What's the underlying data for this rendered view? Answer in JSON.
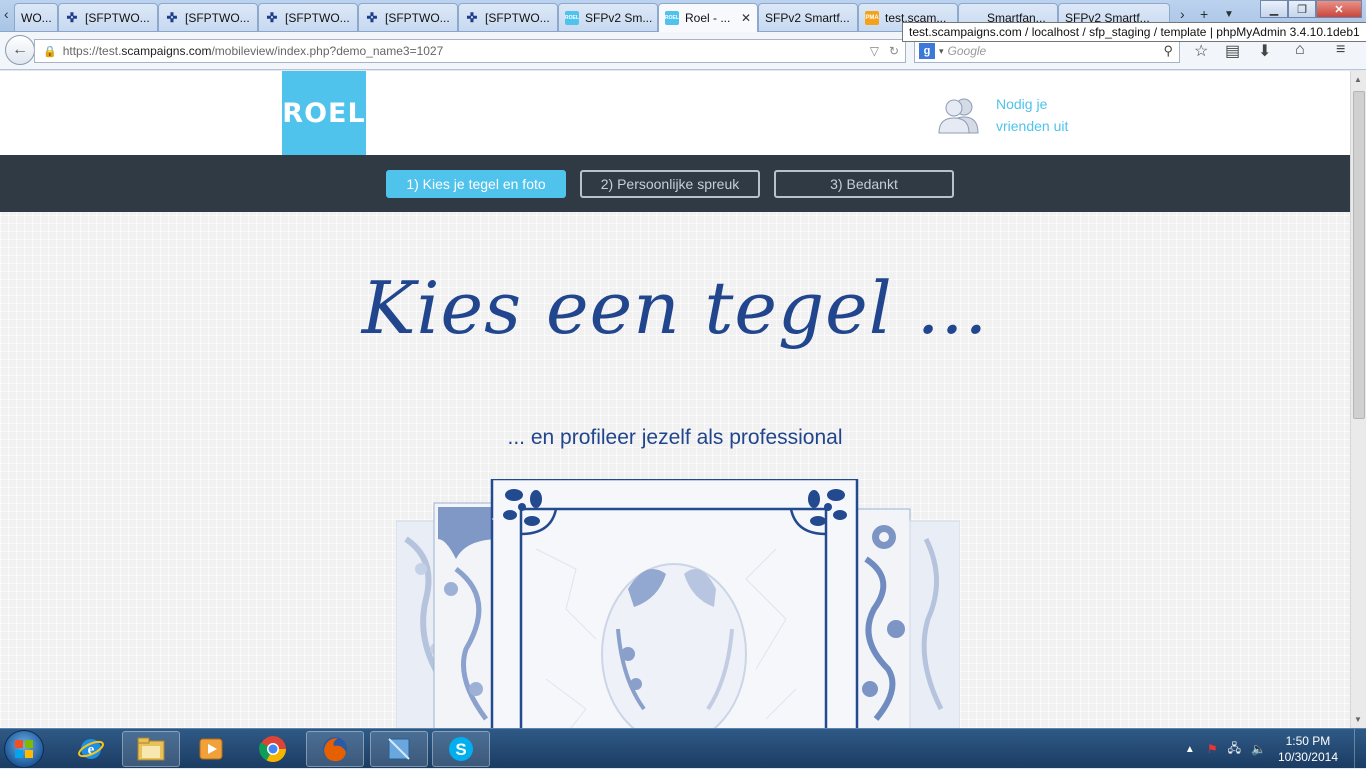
{
  "browser": {
    "tabs": [
      {
        "label": "WO...",
        "icon": "sfp",
        "active": false
      },
      {
        "label": "[SFPTWO...",
        "icon": "sfp",
        "active": false
      },
      {
        "label": "[SFPTWO...",
        "icon": "sfp",
        "active": false
      },
      {
        "label": "[SFPTWO...",
        "icon": "sfp",
        "active": false
      },
      {
        "label": "[SFPTWO...",
        "icon": "sfp",
        "active": false
      },
      {
        "label": "[SFPTWO...",
        "icon": "sfp",
        "active": false
      },
      {
        "label": "SFPv2 Sm...",
        "icon": "roel",
        "active": false
      },
      {
        "label": "Roel - ...",
        "icon": "roel",
        "active": true
      },
      {
        "label": "SFPv2 Smartf...",
        "icon": "none",
        "active": false
      },
      {
        "label": "test.scam...",
        "icon": "pma",
        "active": false
      },
      {
        "label": "Smartfan...",
        "icon": "none",
        "active": false
      },
      {
        "label": "SFPv2 Smartf...",
        "icon": "none",
        "active": false
      }
    ],
    "tooltip": "test.scampaigns.com / localhost / sfp_staging / template | phpMyAdmin 3.4.10.1deb1",
    "url": {
      "prefix": "https://test.",
      "host": "scampaigns.com",
      "path": "/mobileview/index.php?demo_name3=1027"
    },
    "search_placeholder": "Google"
  },
  "site": {
    "logo": "ROEL",
    "invite_line1": "Nodig je",
    "invite_line2": "vrienden uit",
    "steps": [
      {
        "label": "1) Kies je tegel en foto",
        "active": true
      },
      {
        "label": "2) Persoonlijke spreuk",
        "active": false
      },
      {
        "label": "3) Bedankt",
        "active": false
      }
    ],
    "headline": "Kies een tegel ...",
    "subline": "... en profileer jezelf als professional"
  },
  "taskbar": {
    "time": "1:50 PM",
    "date": "10/30/2014"
  },
  "colors": {
    "accent": "#4fc3ec",
    "navy": "#22468e",
    "stepsbar": "#2f3a44"
  }
}
